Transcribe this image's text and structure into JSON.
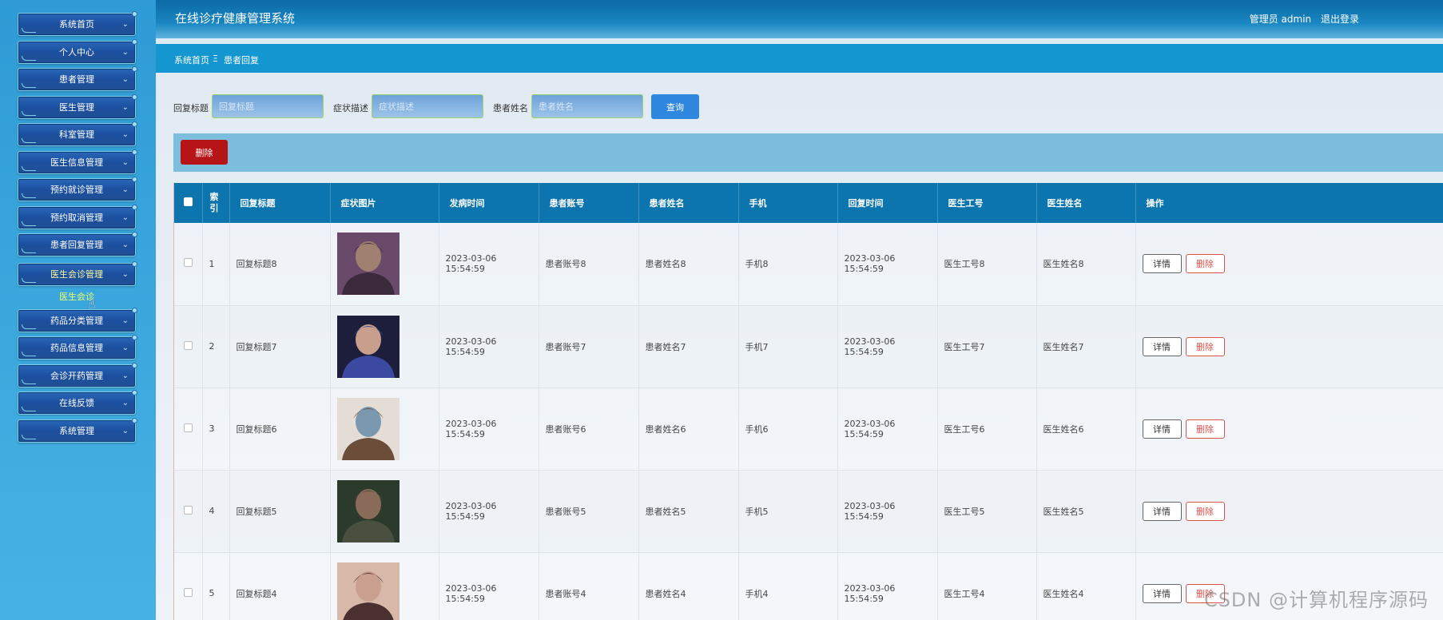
{
  "header": {
    "title": "在线诊疗健康管理系统",
    "user_label": "管理员 admin",
    "logout_label": "退出登录"
  },
  "sidebar": {
    "items": [
      {
        "label": "系统首页"
      },
      {
        "label": "个人中心"
      },
      {
        "label": "患者管理"
      },
      {
        "label": "医生管理"
      },
      {
        "label": "科室管理"
      },
      {
        "label": "医生信息管理"
      },
      {
        "label": "预约就诊管理"
      },
      {
        "label": "预约取消管理"
      },
      {
        "label": "患者回复管理"
      },
      {
        "label": "医生会诊管理"
      },
      {
        "label": "药品分类管理"
      },
      {
        "label": "药品信息管理"
      },
      {
        "label": "会诊开药管理"
      },
      {
        "label": "在线反馈"
      },
      {
        "label": "系统管理"
      }
    ],
    "sub_item_label": "医生会诊"
  },
  "breadcrumb": {
    "home": "系统首页",
    "separator": "Ξ",
    "current": "患者回复"
  },
  "search": {
    "title_label": "回复标题",
    "title_placeholder": "回复标题",
    "symptom_label": "症状描述",
    "symptom_placeholder": "症状描述",
    "name_label": "患者姓名",
    "name_placeholder": "患者姓名",
    "query_button": "查询"
  },
  "actions": {
    "delete_button": "删除"
  },
  "table": {
    "columns": [
      "索引",
      "回复标题",
      "症状图片",
      "发病时间",
      "患者账号",
      "患者姓名",
      "手机",
      "回复时间",
      "医生工号",
      "医生姓名",
      "操作"
    ],
    "index_header": "索\n引",
    "detail_label": "详情",
    "delete_label": "删除",
    "rows": [
      {
        "index": "1",
        "title": "回复标题8",
        "onset": "2023-03-06 15:54:59",
        "account": "患者账号8",
        "name": "患者姓名8",
        "phone": "手机8",
        "reply_time": "2023-03-06 15:54:59",
        "doctor_id": "医生工号8",
        "doctor_name": "医生姓名8",
        "img_colors": [
          "#6a4a6a",
          "#3a2a3c",
          "#a08070"
        ]
      },
      {
        "index": "2",
        "title": "回复标题7",
        "onset": "2023-03-06 15:54:59",
        "account": "患者账号7",
        "name": "患者姓名7",
        "phone": "手机7",
        "reply_time": "2023-03-06 15:54:59",
        "doctor_id": "医生工号7",
        "doctor_name": "医生姓名7",
        "img_colors": [
          "#1c1e3c",
          "#3b4aa0",
          "#c89f8c"
        ]
      },
      {
        "index": "3",
        "title": "回复标题6",
        "onset": "2023-03-06 15:54:59",
        "account": "患者账号6",
        "name": "患者姓名6",
        "phone": "手机6",
        "reply_time": "2023-03-06 15:54:59",
        "doctor_id": "医生工号6",
        "doctor_name": "医生姓名6",
        "img_colors": [
          "#e4ddd6",
          "#6b4e3a",
          "#7a98b0"
        ]
      },
      {
        "index": "4",
        "title": "回复标题5",
        "onset": "2023-03-06 15:54:59",
        "account": "患者账号5",
        "name": "患者姓名5",
        "phone": "手机5",
        "reply_time": "2023-03-06 15:54:59",
        "doctor_id": "医生工号5",
        "doctor_name": "医生姓名5",
        "img_colors": [
          "#2c3a2c",
          "#4a5040",
          "#8a6a58"
        ]
      },
      {
        "index": "5",
        "title": "回复标题4",
        "onset": "2023-03-06 15:54:59",
        "account": "患者账号4",
        "name": "患者姓名4",
        "phone": "手机4",
        "reply_time": "2023-03-06 15:54:59",
        "doctor_id": "医生工号4",
        "doctor_name": "医生姓名4",
        "img_colors": [
          "#d8b8a8",
          "#4a3030",
          "#c9a090"
        ]
      }
    ]
  },
  "watermark": "CSDN @计算机程序源码"
}
